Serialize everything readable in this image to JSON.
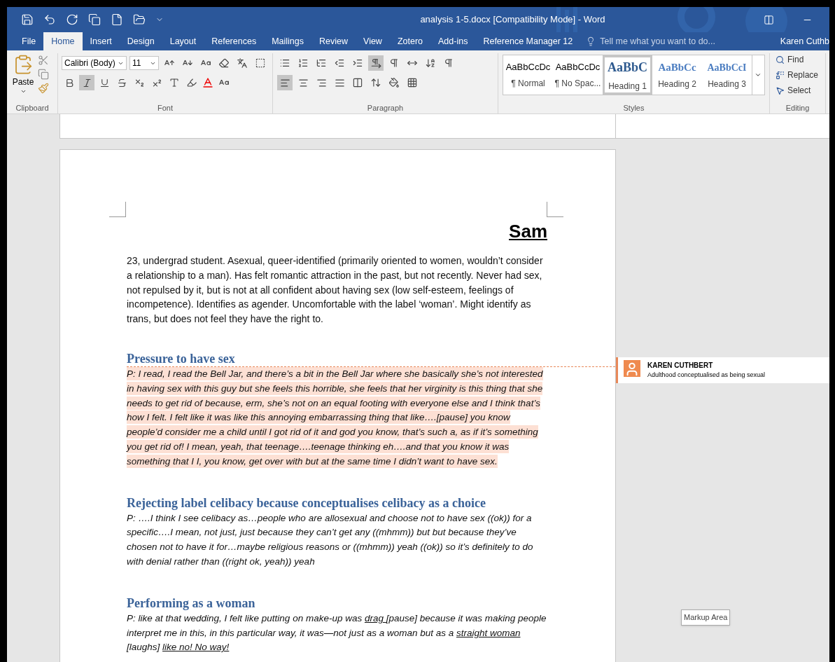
{
  "window": {
    "title": "analysis 1-5.docx [Compatibility Mode] - Word"
  },
  "quick_access": [
    {
      "kind": "save"
    },
    {
      "kind": "undo"
    },
    {
      "kind": "redo"
    },
    {
      "kind": "copy"
    },
    {
      "kind": "new"
    },
    {
      "kind": "open"
    },
    {
      "kind": "customize"
    }
  ],
  "tabs": [
    {
      "label": "File",
      "selected": false
    },
    {
      "label": "Home",
      "selected": true
    },
    {
      "label": "Insert",
      "selected": false
    },
    {
      "label": "Design",
      "selected": false
    },
    {
      "label": "Layout",
      "selected": false
    },
    {
      "label": "References",
      "selected": false
    },
    {
      "label": "Mailings",
      "selected": false
    },
    {
      "label": "Review",
      "selected": false
    },
    {
      "label": "View",
      "selected": false
    },
    {
      "label": "Zotero",
      "selected": false
    },
    {
      "label": "Add-ins",
      "selected": false
    },
    {
      "label": "Reference Manager 12",
      "selected": false
    }
  ],
  "tell_me": {
    "placeholder": "Tell me what you want to do..."
  },
  "user": "Karen Cuthb",
  "clipboard": {
    "paste": "Paste",
    "label": "Clipboard"
  },
  "font": {
    "name": "Calibri (Body)",
    "size": "11",
    "label": "Font",
    "format_buttons": [
      {
        "kind": "bold",
        "selected": false
      },
      {
        "kind": "italic",
        "selected": true
      },
      {
        "kind": "underline",
        "selected": false
      },
      {
        "kind": "strike",
        "selected": false
      },
      {
        "kind": "subscript",
        "selected": false
      },
      {
        "kind": "superscript",
        "selected": false
      }
    ]
  },
  "paragraph": {
    "label": "Paragraph",
    "ltr": {
      "selected": true
    },
    "align_buttons": [
      {
        "kind": "left",
        "selected": true
      },
      {
        "kind": "center",
        "selected": false
      },
      {
        "kind": "right",
        "selected": false
      },
      {
        "kind": "justify",
        "selected": false
      }
    ]
  },
  "styles": {
    "label": "Styles",
    "items": [
      {
        "preview": "AaBbCcDc",
        "name": "¶ Normal",
        "kind": "normal",
        "selected": false
      },
      {
        "preview": "AaBbCcDc",
        "name": "¶ No Spac...",
        "kind": "normal",
        "selected": false
      },
      {
        "preview": "AaBbC",
        "name": "Heading 1",
        "kind": "heading1",
        "selected": true
      },
      {
        "preview": "AaBbCc",
        "name": "Heading 2",
        "kind": "heading2",
        "selected": false
      },
      {
        "preview": "AaBbCcI",
        "name": "Heading 3",
        "kind": "heading3",
        "selected": false
      }
    ]
  },
  "editing": {
    "label": "Editing",
    "items": [
      {
        "kind": "find",
        "label": "Find"
      },
      {
        "kind": "replace",
        "label": "Replace"
      },
      {
        "kind": "select",
        "label": "Select"
      }
    ]
  },
  "document": {
    "title": "Sam",
    "blocks": [
      {
        "kind": "body",
        "segments": [
          {
            "text": "23, undergrad student. Asexual, queer-identified (primarily oriented to women, wouldn’t consider a relationship to a man). Has felt romantic attraction in the past, but not recently.  Never had sex, not repulsed by it, but is not at all confident about having sex (low self-esteem, feelings of incompetence). Identifies as agender. Uncomfortable with the label ‘woman’. Might identify as trans, but does not feel they have the right to.",
            "underline": false
          }
        ]
      },
      {
        "kind": "heading",
        "text": "Pressure to have sex"
      },
      {
        "kind": "quote",
        "commented": true,
        "segments": [
          {
            "text": "P: I read, I read the Bell Jar, and there’s a bit in the Bell Jar where she basically she’s not interested in having sex with this guy but she feels this horrible, she feels that her virginity is this thing that she needs to get rid of because, erm, she’s not on an equal footing with everyone else and I think that’s how I felt. I felt like it was like this annoying embarrassing thing that like….[pause] you know people’d consider me a child until I got rid of it and god you know, that’s such a, as if it’s something you get rid of! I mean, yeah, that teenage….teenage thinking eh….and that you know it was something that I I, you know, get over with but at the same time I didn’t want to have sex.",
            "underline": false
          }
        ]
      },
      {
        "kind": "heading",
        "text": "Rejecting label celibacy because conceptualises celibacy as a choice"
      },
      {
        "kind": "quote",
        "commented": false,
        "segments": [
          {
            "text": "P: ….I think I see celibacy as…people who are allosexual and choose not to have sex ((ok)) for a specific….I mean, not just, just because they can’t get any ((mhmm)) but but because they’ve chosen not to have it for…maybe religious reasons or ((mhmm)) yeah ((ok)) so it’s definitely to do with denial rather than ((right ok, yeah)) yeah",
            "underline": false
          }
        ]
      },
      {
        "kind": "heading",
        "text": "Performing as a woman"
      },
      {
        "kind": "quote",
        "commented": false,
        "segments": [
          {
            "text": "P: like at that wedding, I felt like putting on make-up was ",
            "underline": false
          },
          {
            "text": "drag ",
            "underline": true
          },
          {
            "text": "[pause] because it was making people interpret me in this, in this particular way, it was—not just as a woman but as a ",
            "underline": false
          },
          {
            "text": "straight woman",
            "underline": true
          },
          {
            "text": "  [laughs] ",
            "underline": false
          },
          {
            "text": "like no!  No way!",
            "underline": true
          }
        ]
      }
    ]
  },
  "comment": {
    "author": "KAREN CUTHBERT",
    "text": "Adulthood conceptualised as being sexual"
  },
  "tooltip": "Markup Area"
}
